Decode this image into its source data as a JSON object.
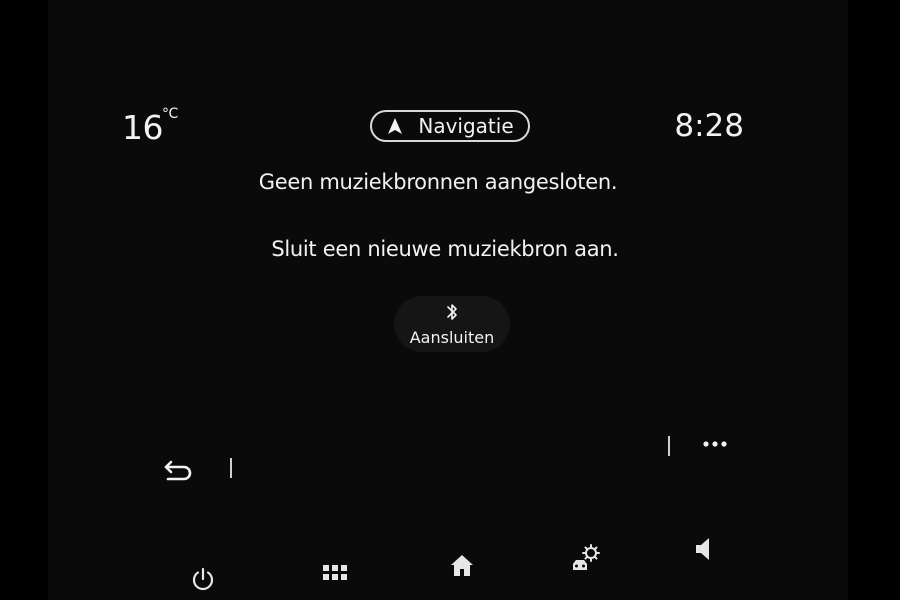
{
  "status_bar": {
    "temperature": "16",
    "temperature_unit": "°C",
    "time": "8:28"
  },
  "navigation_button": {
    "label": "Navigatie",
    "icon": "navigation-arrow-icon"
  },
  "message": {
    "line1": "Geen muziekbronnen aangesloten.",
    "line2": "Sluit een nieuwe muziekbron aan."
  },
  "connect_button": {
    "label": "Aansluiten",
    "icon": "bluetooth-icon"
  },
  "toolbar": {
    "back_icon": "back-arrow-icon",
    "more_icon": "more-options-icon"
  },
  "bottom_bar": {
    "icons": [
      "power-icon",
      "apps-grid-icon",
      "home-icon",
      "car-settings-icon",
      "volume-icon"
    ]
  },
  "colors": {
    "background": "#0a0a0a",
    "foreground": "#f2f2f2"
  }
}
